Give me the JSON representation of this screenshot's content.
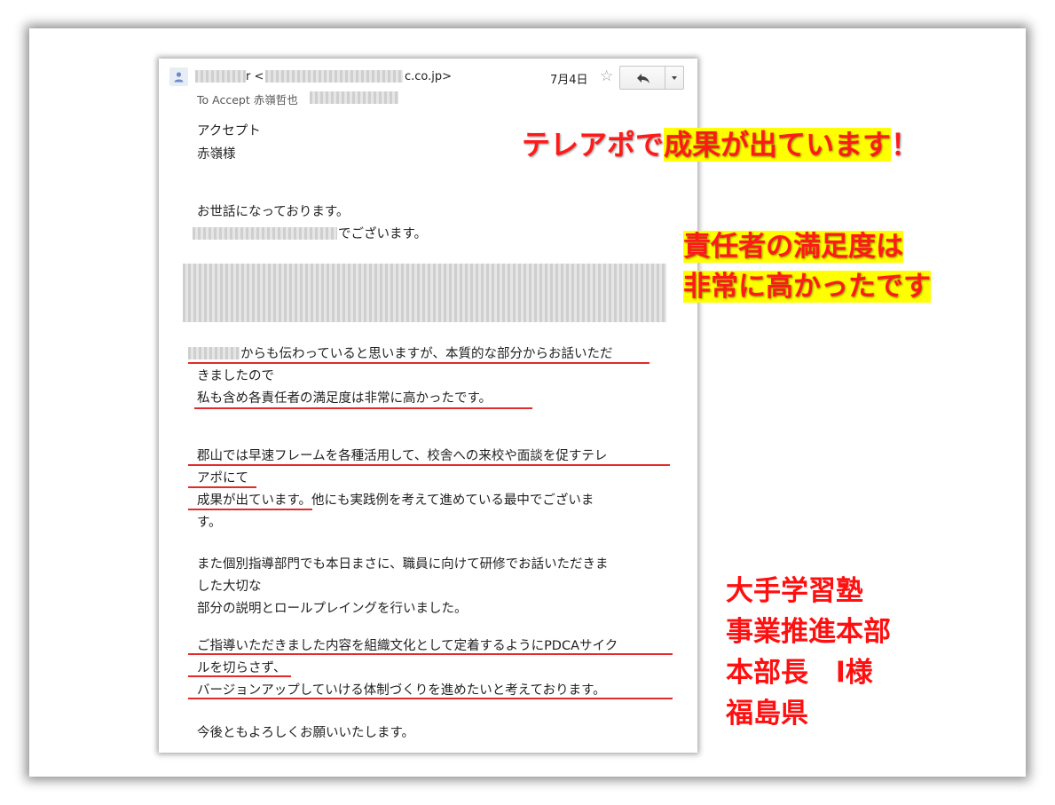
{
  "email": {
    "from_suffix": "r <",
    "from_domain": "c.co.jp>",
    "date": "7月4日",
    "to_prefix": "To Accept 赤嶺哲也",
    "recipient_company": "アクセプト",
    "recipient_name": "赤嶺様",
    "greeting": "お世話になっております。",
    "self_intro_suffix": "でございます。",
    "para1": {
      "line1": "からも伝わっていると思いますが、本質的な部分からお話いただ",
      "line2": "きましたので",
      "line3": "私も含め各責任者の満足度は非常に高かったです。"
    },
    "para2": {
      "line1": "郡山では早速フレームを各種活用して、校舎への来校や面談を促すテレ",
      "line2": "アポにて",
      "line3": "成果が出ています。他にも実践例を考えて進めている最中でございま",
      "line4": "す。"
    },
    "para3": {
      "line1": "また個別指導部門でも本日まさに、職員に向けて研修でお話いただきま",
      "line2": "した大切な",
      "line3": "部分の説明とロールプレイングを行いました。"
    },
    "para4": {
      "line1": "ご指導いただきました内容を組織文化として定着するようにPDCAサイク",
      "line2": "ルを切らさず、",
      "line3": "バージョンアップしていける体制づくりを進めたいと考えております。"
    },
    "closing": "今後ともよろしくお願いいたします。"
  },
  "callouts": {
    "result_prefix": "テレアポで",
    "result_marked": "成果が出ています",
    "result_suffix": "！",
    "satisfaction_line1": "責任者の満足度は",
    "satisfaction_line2": "非常に高かったです"
  },
  "sender_info": {
    "line1": "大手学習塾",
    "line2": "事業推進本部",
    "line3": "本部長　l様",
    "line4": "福島県"
  },
  "icons": [
    "person-icon",
    "star-icon",
    "reply-arrow-icon",
    "dropdown-arrow-icon"
  ],
  "colors": {
    "highlight_red": "#ff1a1a",
    "highlight_yellow": "#ffff00",
    "underline_red": "#e22b2b"
  }
}
